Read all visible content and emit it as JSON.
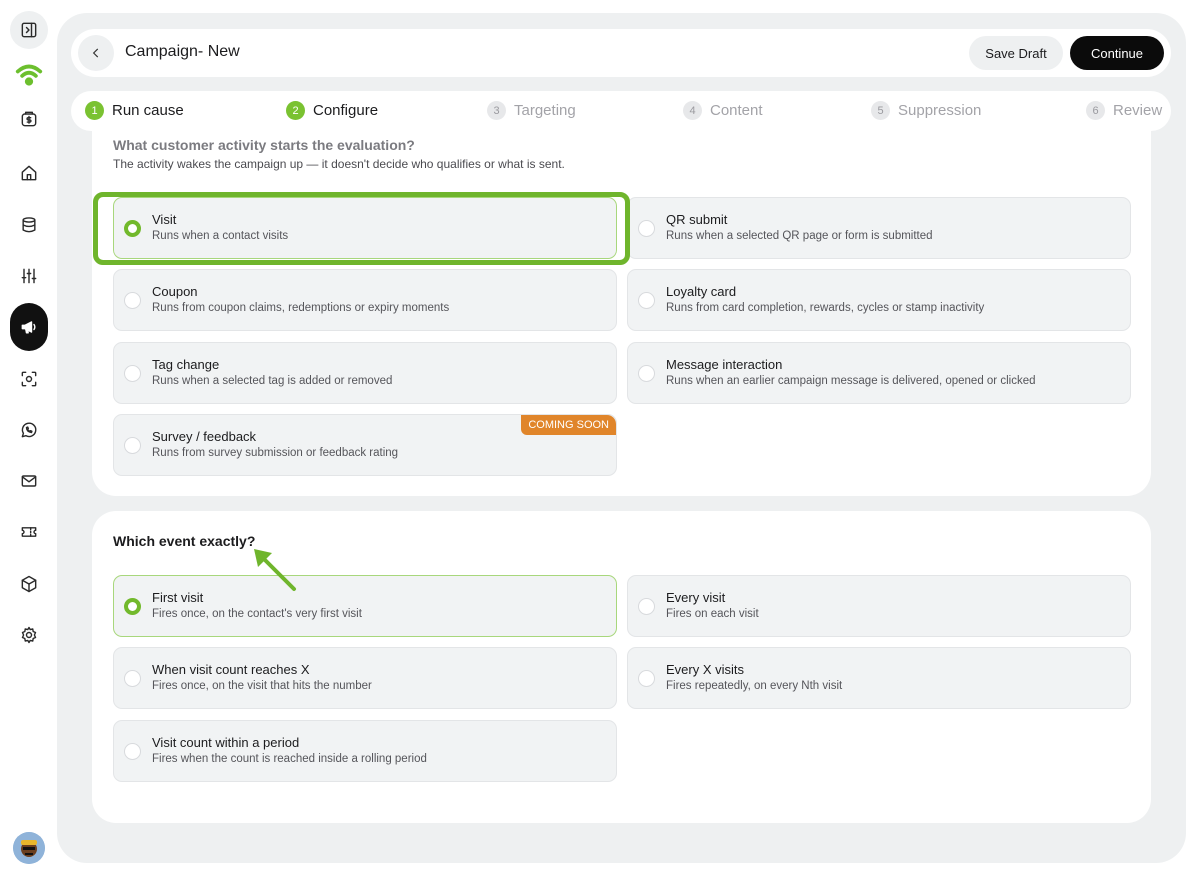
{
  "header": {
    "title": "Campaign- New",
    "save_draft": "Save Draft",
    "continue": "Continue"
  },
  "steps": [
    {
      "num": "1",
      "label": "Run cause"
    },
    {
      "num": "2",
      "label": "Configure"
    },
    {
      "num": "3",
      "label": "Targeting"
    },
    {
      "num": "4",
      "label": "Content"
    },
    {
      "num": "5",
      "label": "Suppression"
    },
    {
      "num": "6",
      "label": "Review"
    }
  ],
  "trigger_section": {
    "title": "What customer activity starts the evaluation?",
    "subtitle": "The activity wakes the campaign up — it doesn't decide who qualifies or what is sent.",
    "options": [
      {
        "title": "Visit",
        "desc": "Runs when a contact visits"
      },
      {
        "title": "QR submit",
        "desc": "Runs when a selected QR page or form is submitted"
      },
      {
        "title": "Coupon",
        "desc": "Runs from coupon claims, redemptions or expiry moments"
      },
      {
        "title": "Loyalty card",
        "desc": "Runs from card completion, rewards, cycles or stamp inactivity"
      },
      {
        "title": "Tag change",
        "desc": "Runs when a selected tag is added or removed"
      },
      {
        "title": "Message interaction",
        "desc": "Runs when an earlier campaign message is delivered, opened or clicked"
      },
      {
        "title": "Survey / feedback",
        "desc": "Runs from survey submission or feedback rating",
        "badge": "COMING SOON"
      }
    ],
    "selected": "Visit"
  },
  "event_section": {
    "title": "Which event exactly?",
    "options": [
      {
        "title": "First visit",
        "desc": "Fires once, on the contact's very first visit"
      },
      {
        "title": "Every visit",
        "desc": "Fires on each visit"
      },
      {
        "title": "When visit count reaches X",
        "desc": "Fires once, on the visit that hits the number"
      },
      {
        "title": "Every X visits",
        "desc": "Fires repeatedly, on every Nth visit"
      },
      {
        "title": "Visit count within a period",
        "desc": "Fires when the count is reached inside a rolling period"
      }
    ],
    "selected": "First visit"
  },
  "colors": {
    "accent_green": "#72b92c",
    "highlight_green": "#6fb52c",
    "badge_orange": "#e0852a",
    "primary_black": "#0b0b0b"
  },
  "icons": [
    "sidebar-toggle-icon",
    "wifi-logo-icon",
    "wallet-icon",
    "home-icon",
    "database-icon",
    "sliders-icon",
    "megaphone-icon",
    "scan-icon",
    "whatsapp-icon",
    "mail-icon",
    "ticket-icon",
    "box-icon",
    "settings-icon"
  ]
}
